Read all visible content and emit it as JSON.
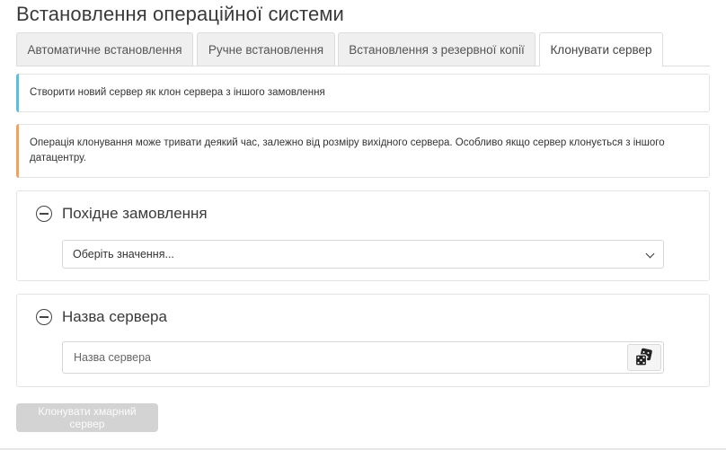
{
  "page": {
    "title": "Встановлення операційної системи"
  },
  "tabs": [
    {
      "label": "Автоматичне встановлення",
      "active": false
    },
    {
      "label": "Ручне встановлення",
      "active": false
    },
    {
      "label": "Встановлення з резервної копії",
      "active": false
    },
    {
      "label": "Клонувати сервер",
      "active": true
    }
  ],
  "alerts": {
    "info": {
      "text": "Створити новий сервер як клон сервера з іншого замовлення",
      "accent": "#5bc0de"
    },
    "warning": {
      "text": "Операція клонування може тривати деякий час, залежно від розміру вихідного сервера. Особливо якщо сервер клонується з іншого датацентру.",
      "accent": "#f0a35e"
    }
  },
  "source_order": {
    "title": "Похідне замовлення",
    "select_value": "Оберіть значення...",
    "icon": "minus-circle-icon"
  },
  "server_name": {
    "title": "Назва сервера",
    "placeholder": "Назва сервера",
    "value": "",
    "generate_icon": "dice-icon"
  },
  "actions": {
    "submit_label": "Клонувати хмарний сервер",
    "submit_disabled": true
  }
}
